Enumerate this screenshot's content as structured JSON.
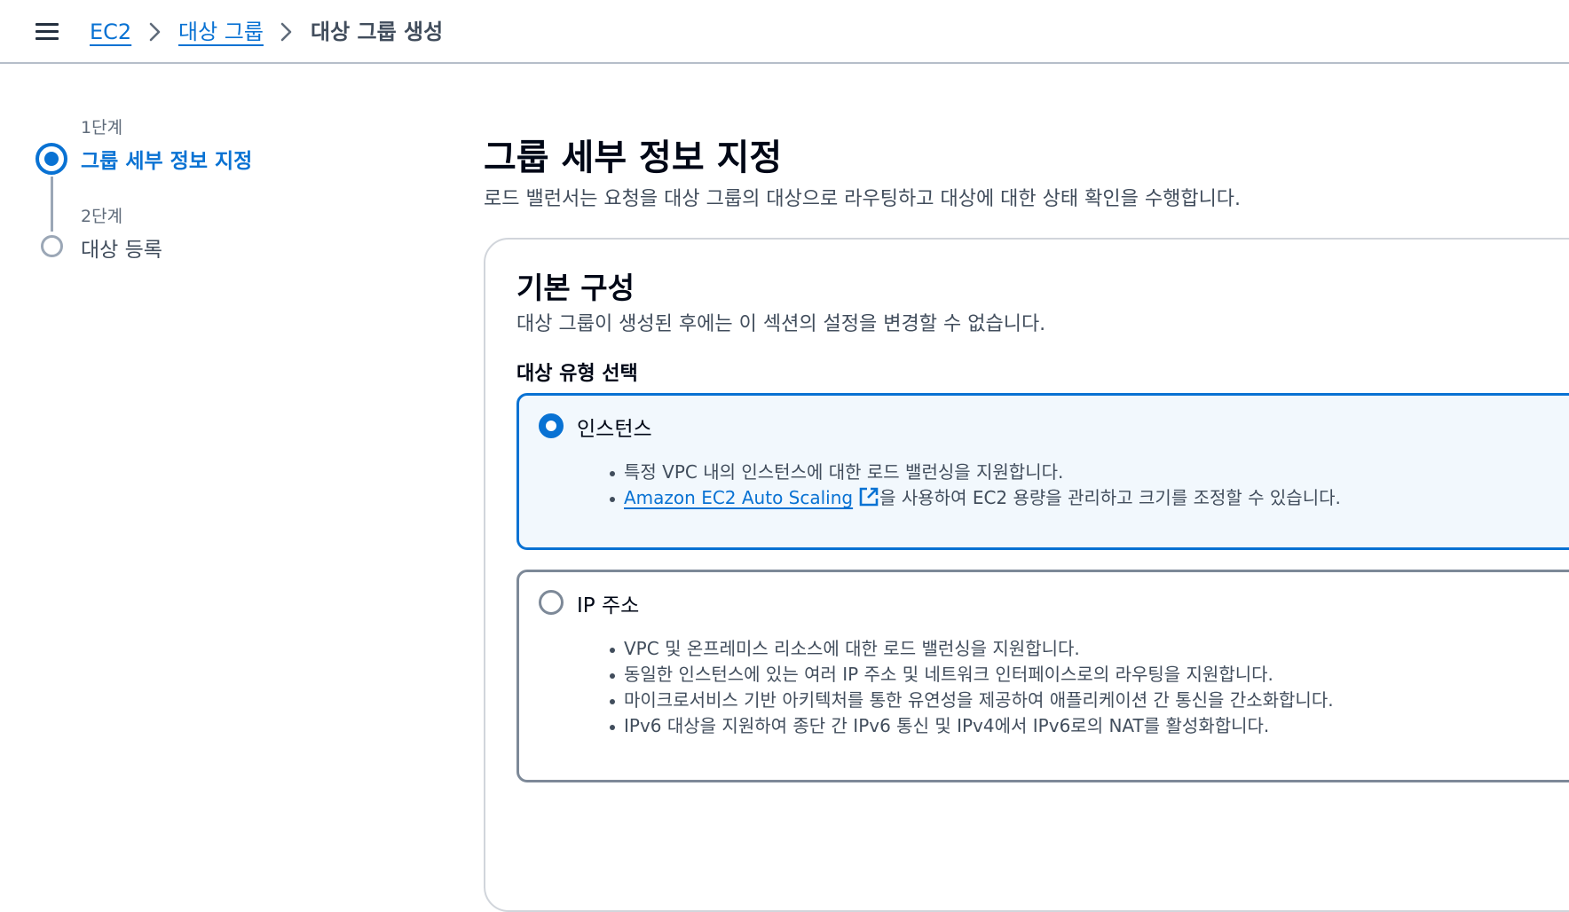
{
  "breadcrumb": {
    "items": [
      "EC2",
      "대상 그룹"
    ],
    "current": "대상 그룹 생성"
  },
  "steps": [
    {
      "label": "1단계",
      "title": "그룹 세부 정보 지정",
      "active": true
    },
    {
      "label": "2단계",
      "title": "대상 등록",
      "active": false
    }
  ],
  "main": {
    "title": "그룹 세부 정보 지정",
    "description": "로드 밸런서는 요청을 대상 그룹의 대상으로 라우팅하고 대상에 대한 상태 확인을 수행합니다."
  },
  "basic_config": {
    "title": "기본 구성",
    "description": "대상 그룹이 생성된 후에는 이 섹션의 설정을 변경할 수 없습니다.",
    "target_type_label": "대상 유형 선택",
    "options": [
      {
        "title": "인스턴스",
        "selected": true,
        "bullets": [
          "특정 VPC 내의 인스턴스에 대한 로드 밸런싱을 지원합니다."
        ],
        "link_bullet": {
          "link_text": "Amazon EC2 Auto Scaling",
          "suffix": "을 사용하여 EC2 용량을 관리하고 크기를 조정할 수 있습니다."
        }
      },
      {
        "title": "IP 주소",
        "selected": false,
        "bullets": [
          "VPC 및 온프레미스 리소스에 대한 로드 밸런싱을 지원합니다.",
          "동일한 인스턴스에 있는 여러 IP 주소 및 네트워크 인터페이스로의 라우팅을 지원합니다.",
          "마이크로서비스 기반 아키텍처를 통한 유연성을 제공하여 애플리케이션 간 통신을 간소화합니다.",
          "IPv6 대상을 지원하여 종단 간 IPv6 통신 및 IPv4에서 IPv6로의 NAT를 활성화합니다."
        ]
      }
    ]
  },
  "icons": {
    "menu": "hamburger-menu-icon",
    "chevron": "chevron-right-icon",
    "external": "external-link-icon"
  },
  "colors": {
    "accent": "#0972d3",
    "text": "#16191f",
    "muted": "#414d5c",
    "border": "#7d8998",
    "selected_bg": "#f2f8fd"
  }
}
